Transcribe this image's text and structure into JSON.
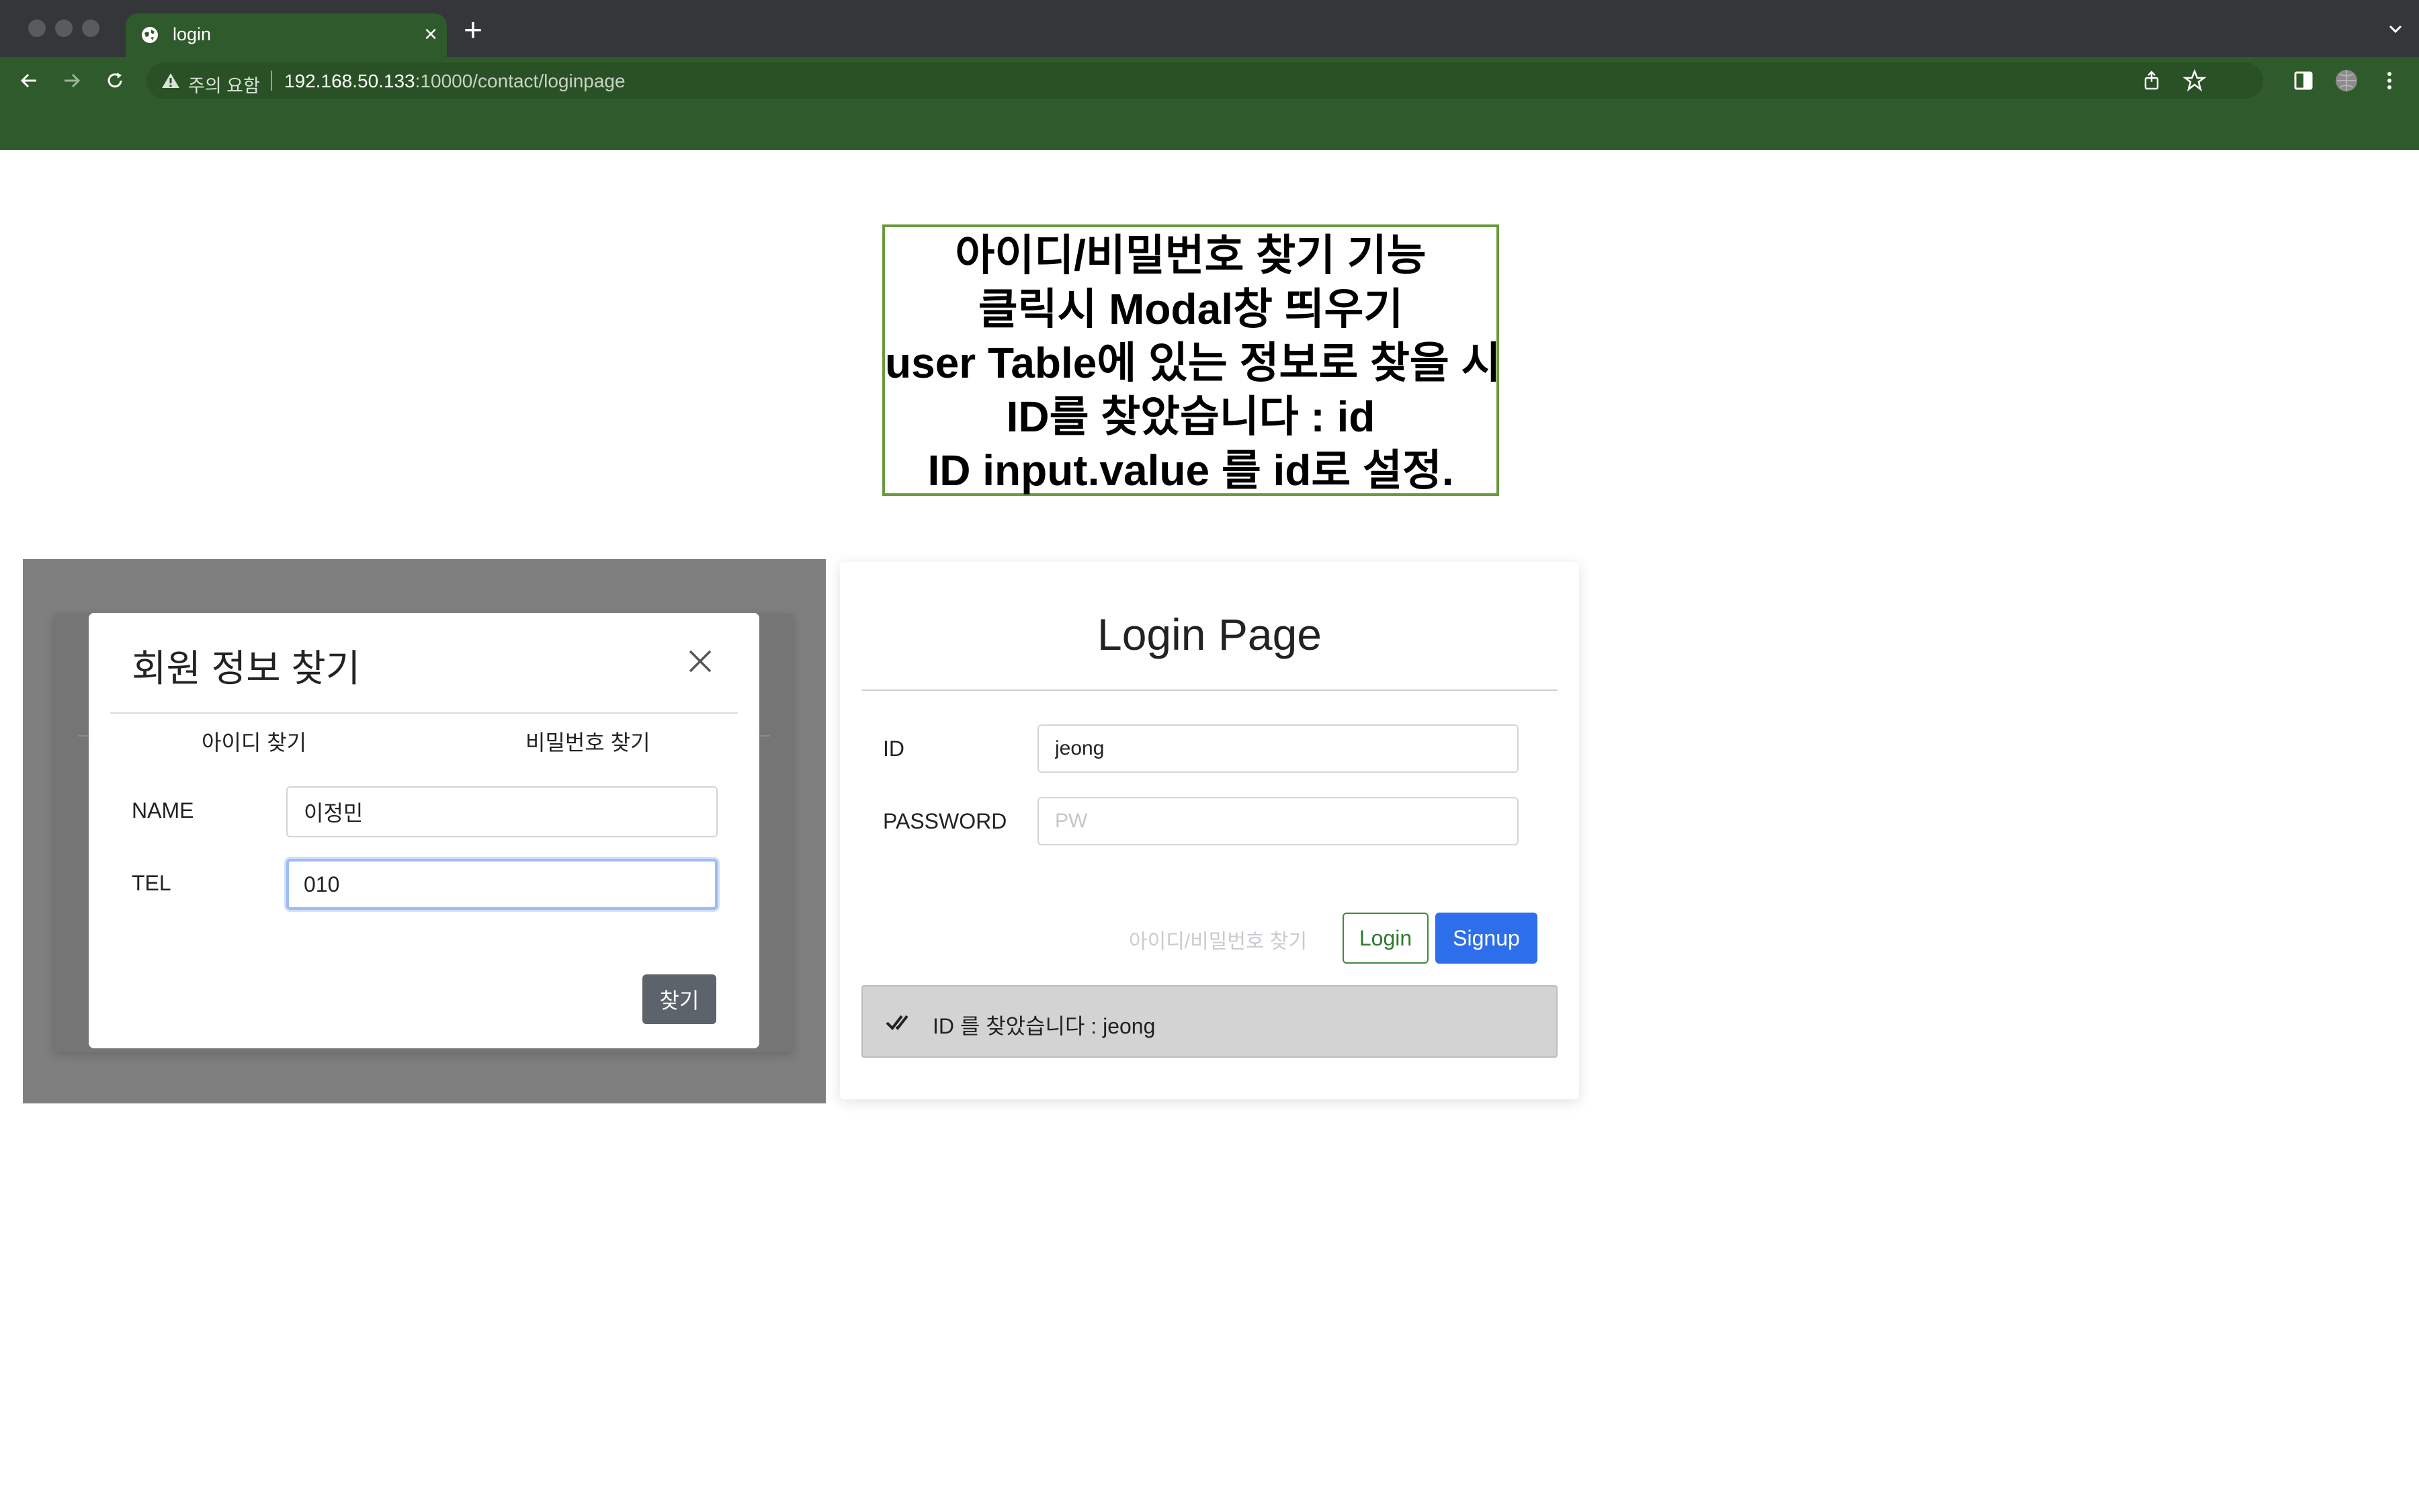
{
  "browser": {
    "tab_title": "login",
    "tab_close": "×",
    "new_tab": "+",
    "security_warning": "주의 요함",
    "url_host": "192.168.50.133",
    "url_path": ":10000/contact/loginpage"
  },
  "note": {
    "lines": [
      "아이디/비밀번호 찾기 기능",
      "클릭시 Modal창 띄우기",
      "user Table에 있는 정보로 찾을 시",
      "ID를 찾았습니다 : id",
      "ID input.value 를 id로 설정."
    ]
  },
  "modal": {
    "title": "회원 정보 찾기",
    "tabs": [
      "아이디 찾기",
      "비밀번호 찾기"
    ],
    "name_label": "NAME",
    "name_value": "이정민",
    "tel_label": "TEL",
    "tel_value": "010",
    "find_button": "찾기"
  },
  "login": {
    "title": "Login Page",
    "id_label": "ID",
    "id_value": "jeong",
    "password_label": "PASSWORD",
    "password_placeholder": "PW",
    "find_link": "아이디/비밀번호 찾기",
    "login_button": "Login",
    "signup_button": "Signup",
    "alert_text": "ID 를 찾았습니다 : jeong"
  }
}
